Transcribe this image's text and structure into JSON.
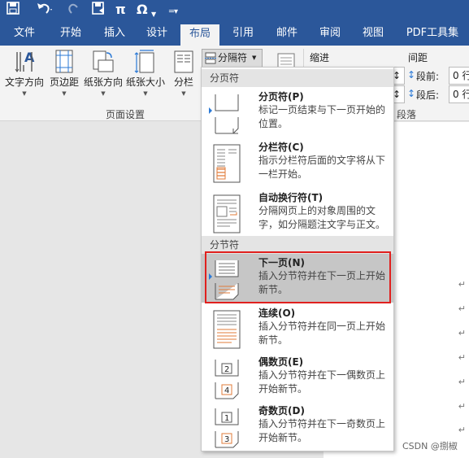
{
  "qat": {
    "icons": [
      "save-icon",
      "undo-icon",
      "redo-icon",
      "save-as-icon",
      "pi-icon",
      "omega-icon",
      "customize-icon"
    ],
    "pi": "π",
    "omega": "Ω"
  },
  "tabs": [
    "文件",
    "开始",
    "插入",
    "设计",
    "布局",
    "引用",
    "邮件",
    "审阅",
    "视图",
    "PDF工具集"
  ],
  "active_tab": "布局",
  "ribbon": {
    "buttons": [
      "文字方向",
      "页边距",
      "纸张方向",
      "纸张大小",
      "分栏"
    ],
    "group_label": "页面设置",
    "breaks_button": "分隔符",
    "indent_label": "缩进",
    "spacing_label": "间距",
    "spacing_before_label": "段前:",
    "spacing_after_label": "段后:",
    "spacing_before_value": "0 行",
    "spacing_after_value": "0 行",
    "paragraph_group": "段落"
  },
  "menu": {
    "section_page_breaks": "分页符",
    "section_section_breaks": "分节符",
    "items": [
      {
        "title": "分页符(P)",
        "desc": "标记一页结束与下一页开始的位置。"
      },
      {
        "title": "分栏符(C)",
        "desc": "指示分栏符后面的文字将从下一栏开始。"
      },
      {
        "title": "自动换行符(T)",
        "desc": "分隔网页上的对象周围的文字，如分隔题注文字与正文。"
      },
      {
        "title": "下一页(N)",
        "desc": "插入分节符并在下一页上开始新节。"
      },
      {
        "title": "连续(O)",
        "desc": "插入分节符并在同一页上开始新节。"
      },
      {
        "title": "偶数页(E)",
        "desc": "插入分节符并在下一偶数页上开始新节。"
      },
      {
        "title": "奇数页(D)",
        "desc": "插入分节符并在下一奇数页上开始新节。"
      }
    ],
    "selected": "下一页(N)",
    "even_num": "2",
    "even_num2": "4",
    "odd_num": "1",
    "odd_num2": "3"
  },
  "doc": {
    "para_mark": "↵"
  },
  "watermark": "CSDN @捌椒",
  "colors": {
    "brand": "#2b579a",
    "highlight_border": "#e0201e",
    "accent_orange": "#e07b39"
  }
}
